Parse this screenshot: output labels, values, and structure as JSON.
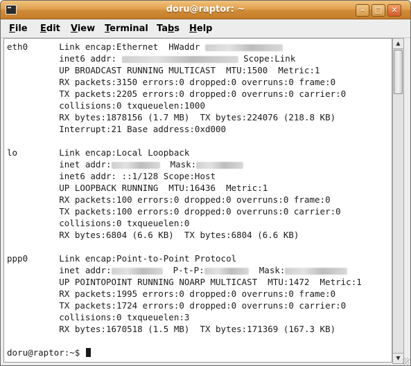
{
  "window": {
    "title": "doru@raptor: ~",
    "minimize_glyph": "–",
    "maximize_glyph": "□",
    "close_glyph": "✕",
    "icon": "terminal-icon",
    "accent": "#d08c36"
  },
  "menubar": {
    "items": [
      {
        "label_u": "F",
        "label_rest": "ile"
      },
      {
        "label_u": "E",
        "label_rest": "dit"
      },
      {
        "label_u": "V",
        "label_rest": "iew"
      },
      {
        "label_u": "T",
        "label_rest": "erminal"
      },
      {
        "label_pre": "Ta",
        "label_u": "b",
        "label_rest": "s"
      },
      {
        "label_u": "H",
        "label_rest": "elp"
      }
    ]
  },
  "terminal": {
    "lines": [
      {
        "segments": [
          {
            "text": "eth0      Link encap:Ethernet  HWaddr "
          },
          {
            "redacted": true,
            "width": 112
          }
        ]
      },
      {
        "segments": [
          {
            "text": "          inet6 addr: "
          },
          {
            "redacted": true,
            "width": 168
          },
          {
            "text": " Scope:Link"
          }
        ]
      },
      {
        "segments": [
          {
            "text": "          UP BROADCAST RUNNING MULTICAST  MTU:1500  Metric:1"
          }
        ]
      },
      {
        "segments": [
          {
            "text": "          RX packets:3150 errors:0 dropped:0 overruns:0 frame:0"
          }
        ]
      },
      {
        "segments": [
          {
            "text": "          TX packets:2205 errors:0 dropped:0 overruns:0 carrier:0"
          }
        ]
      },
      {
        "segments": [
          {
            "text": "          collisions:0 txqueuelen:1000"
          }
        ]
      },
      {
        "segments": [
          {
            "text": "          RX bytes:1878156 (1.7 MB)  TX bytes:224076 (218.8 KB)"
          }
        ]
      },
      {
        "segments": [
          {
            "text": "          Interrupt:21 Base address:0xd000"
          }
        ]
      },
      {
        "segments": [
          {
            "text": ""
          }
        ]
      },
      {
        "segments": [
          {
            "text": "lo        Link encap:Local Loopback"
          }
        ]
      },
      {
        "segments": [
          {
            "text": "          inet addr:"
          },
          {
            "redacted": true,
            "width": 70
          },
          {
            "text": "  Mask:"
          },
          {
            "redacted": true,
            "width": 68
          }
        ]
      },
      {
        "segments": [
          {
            "text": "          inet6 addr: ::1/128 Scope:Host"
          }
        ]
      },
      {
        "segments": [
          {
            "text": "          UP LOOPBACK RUNNING  MTU:16436  Metric:1"
          }
        ]
      },
      {
        "segments": [
          {
            "text": "          RX packets:100 errors:0 dropped:0 overruns:0 frame:0"
          }
        ]
      },
      {
        "segments": [
          {
            "text": "          TX packets:100 errors:0 dropped:0 overruns:0 carrier:0"
          }
        ]
      },
      {
        "segments": [
          {
            "text": "          collisions:0 txqueuelen:0"
          }
        ]
      },
      {
        "segments": [
          {
            "text": "          RX bytes:6804 (6.6 KB)  TX bytes:6804 (6.6 KB)"
          }
        ]
      },
      {
        "segments": [
          {
            "text": ""
          }
        ]
      },
      {
        "segments": [
          {
            "text": "ppp0      Link encap:Point-to-Point Protocol"
          }
        ]
      },
      {
        "segments": [
          {
            "text": "          inet addr:"
          },
          {
            "redacted": true,
            "width": 74
          },
          {
            "text": "  P-t-P:"
          },
          {
            "redacted": true,
            "width": 64
          },
          {
            "text": "  Mask:"
          },
          {
            "redacted": true,
            "width": 90
          }
        ]
      },
      {
        "segments": [
          {
            "text": "          UP POINTOPOINT RUNNING NOARP MULTICAST  MTU:1472  Metric:1"
          }
        ]
      },
      {
        "segments": [
          {
            "text": "          RX packets:1995 errors:0 dropped:0 overruns:0 frame:0"
          }
        ]
      },
      {
        "segments": [
          {
            "text": "          TX packets:1724 errors:0 dropped:0 overruns:0 carrier:0"
          }
        ]
      },
      {
        "segments": [
          {
            "text": "          collisions:0 txqueuelen:3"
          }
        ]
      },
      {
        "segments": [
          {
            "text": "          RX bytes:1670518 (1.5 MB)  TX bytes:171369 (167.3 KB)"
          }
        ]
      },
      {
        "segments": [
          {
            "text": ""
          }
        ]
      },
      {
        "segments": [
          {
            "text": "doru@raptor:~$ "
          }
        ],
        "cursor": true
      }
    ]
  },
  "scrollbar": {
    "up_glyph": "▲",
    "down_glyph": "▼",
    "position_fraction": 0.0
  }
}
